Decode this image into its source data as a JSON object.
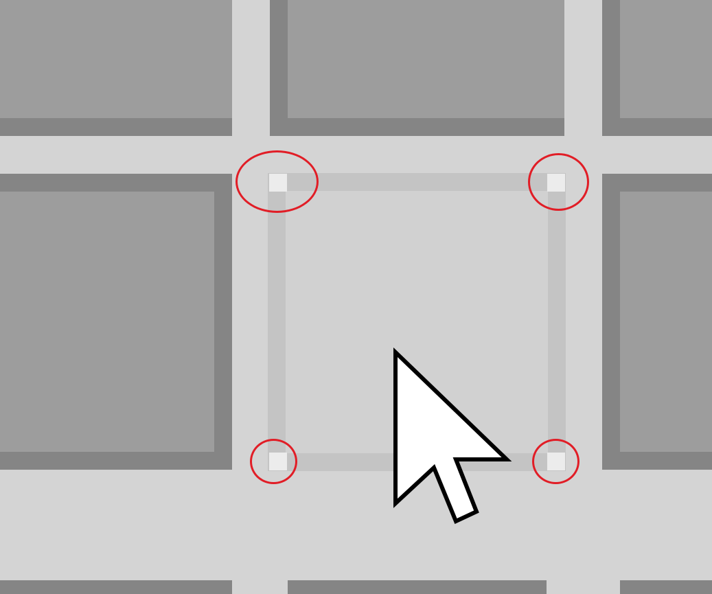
{
  "screen": {
    "description_free": true
  },
  "grid": {
    "tile_count_visible": 9,
    "selected_tile": "center",
    "colors": {
      "background": "#d4d4d4",
      "tile_face": "#9d9d9d",
      "tile_shadow": "#858585",
      "selected_face": "#d1d1d1",
      "selected_border": "#c4c4c4",
      "corner_marker": "#ececec",
      "annotation": "#e11d26"
    }
  },
  "annotations": {
    "count": 4,
    "shape": "ellipse",
    "targets": [
      "top-left-corner",
      "top-right-corner",
      "bottom-left-corner",
      "bottom-right-corner"
    ]
  },
  "cursor": {
    "icon": "arrow-pointer-icon"
  }
}
